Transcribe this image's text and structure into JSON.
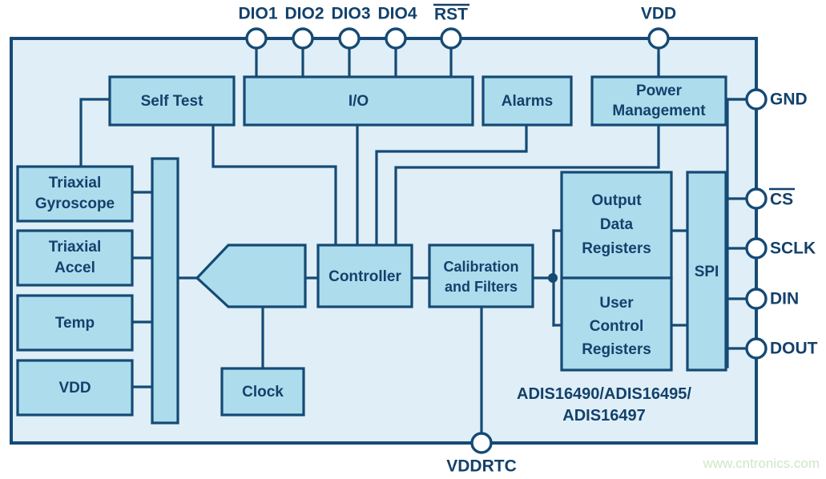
{
  "diagram": {
    "title": "ADIS16490/ADIS16495/ADIS16497 Functional Block Diagram",
    "part_label_line1": "ADIS16490/ADIS16495/",
    "part_label_line2": "ADIS16497",
    "watermark": "www.cntronics.com",
    "colors": {
      "block_fill": "#ADDCED",
      "chip_fill": "#DFEEF7",
      "outline": "#154A75",
      "text": "#13416B",
      "page_background": "#FFFFFF",
      "watermark": "#CDE8C4"
    }
  },
  "blocks": {
    "self_test": "Self Test",
    "io": "I/O",
    "alarms": "Alarms",
    "power_management_line1": "Power",
    "power_management_line2": "Management",
    "triaxial_gyroscope_line1": "Triaxial",
    "triaxial_gyroscope_line2": "Gyroscope",
    "triaxial_accel_line1": "Triaxial",
    "triaxial_accel_line2": "Accel",
    "temp": "Temp",
    "vdd_sensor": "VDD",
    "sensor_bus": "",
    "mux": "",
    "clock": "Clock",
    "controller": "Controller",
    "calibration_line1": "Calibration",
    "calibration_line2": "and Filters",
    "output_data_registers_line1": "Output",
    "output_data_registers_line2": "Data",
    "output_data_registers_line3": "Registers",
    "user_control_registers_line1": "User",
    "user_control_registers_line2": "Control",
    "user_control_registers_line3": "Registers",
    "spi": "SPI"
  },
  "pins": {
    "top": [
      {
        "label": "DIO1",
        "overbar": false
      },
      {
        "label": "DIO2",
        "overbar": false
      },
      {
        "label": "DIO3",
        "overbar": false
      },
      {
        "label": "DIO4",
        "overbar": false
      },
      {
        "label": "RST",
        "overbar": true
      },
      {
        "label": "VDD",
        "overbar": false
      }
    ],
    "right": [
      {
        "label": "GND",
        "overbar": false
      },
      {
        "label": "CS",
        "overbar": true
      },
      {
        "label": "SCLK",
        "overbar": false
      },
      {
        "label": "DIN",
        "overbar": false
      },
      {
        "label": "DOUT",
        "overbar": false
      }
    ],
    "bottom": [
      {
        "label": "VDDRTC",
        "overbar": false
      }
    ]
  }
}
